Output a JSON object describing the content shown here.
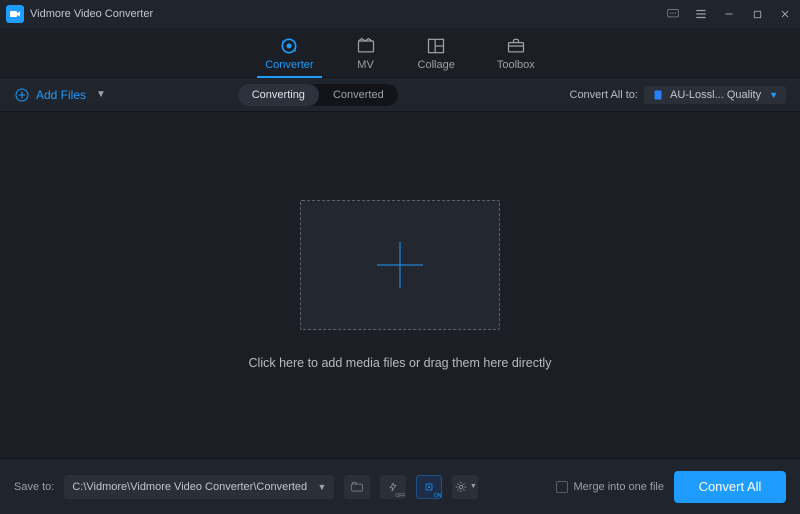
{
  "app": {
    "title": "Vidmore Video Converter"
  },
  "tabs": {
    "converter": "Converter",
    "mv": "MV",
    "collage": "Collage",
    "toolbox": "Toolbox"
  },
  "actionbar": {
    "add_files": "Add Files",
    "segment": {
      "converting": "Converting",
      "converted": "Converted"
    },
    "convert_all_to_label": "Convert All to:",
    "format_label": "AU-Lossl... Quality"
  },
  "dropzone": {
    "hint": "Click here to add media files or drag them here directly"
  },
  "bottombar": {
    "save_to_label": "Save to:",
    "save_path": "C:\\Vidmore\\Vidmore Video Converter\\Converted",
    "merge_label": "Merge into one file",
    "convert_all": "Convert All",
    "hw_off": "OFF",
    "gpu_on": "ON"
  }
}
